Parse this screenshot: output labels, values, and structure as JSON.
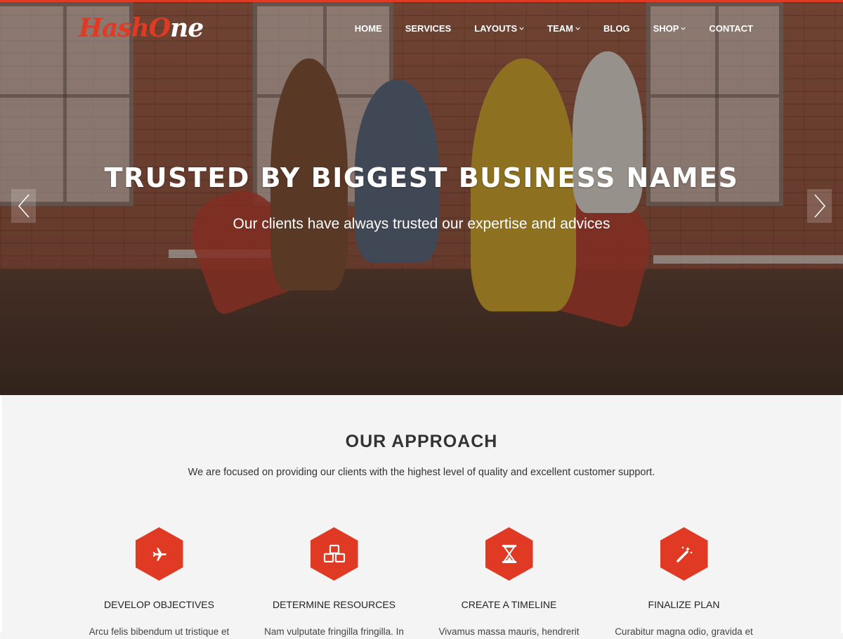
{
  "brand": {
    "logo_part1": "Hash",
    "logo_part2": "O",
    "logo_part3": "ne",
    "accent_color": "#e03a24"
  },
  "nav": {
    "items": [
      {
        "label": "HOME",
        "dropdown": false
      },
      {
        "label": "SERVICES",
        "dropdown": false
      },
      {
        "label": "LAYOUTS",
        "dropdown": true
      },
      {
        "label": "TEAM",
        "dropdown": true
      },
      {
        "label": "BLOG",
        "dropdown": false
      },
      {
        "label": "SHOP",
        "dropdown": true
      },
      {
        "label": "CONTACT",
        "dropdown": false
      }
    ]
  },
  "hero": {
    "title": "TRUSTED BY BIGGEST BUSINESS NAMES",
    "subtitle": "Our clients have always trusted our expertise and advices",
    "prev_icon": "chevron-left-icon",
    "next_icon": "chevron-right-icon"
  },
  "approach": {
    "title": "OUR APPROACH",
    "description": "We are focused on providing our clients with the highest level of quality and excellent customer support.",
    "features": [
      {
        "icon": "plane-icon",
        "title": "DEVELOP OBJECTIVES",
        "text": "Arcu felis bibendum ut tristique et"
      },
      {
        "icon": "cubes-icon",
        "title": "DETERMINE RESOURCES",
        "text": "Nam vulputate fringilla fringilla. In"
      },
      {
        "icon": "hourglass-icon",
        "title": "CREATE A TIMELINE",
        "text": "Vivamus massa mauris, hendrerit"
      },
      {
        "icon": "magic-wand-icon",
        "title": "FINALIZE PLAN",
        "text": "Curabitur magna odio, gravida et"
      }
    ]
  }
}
